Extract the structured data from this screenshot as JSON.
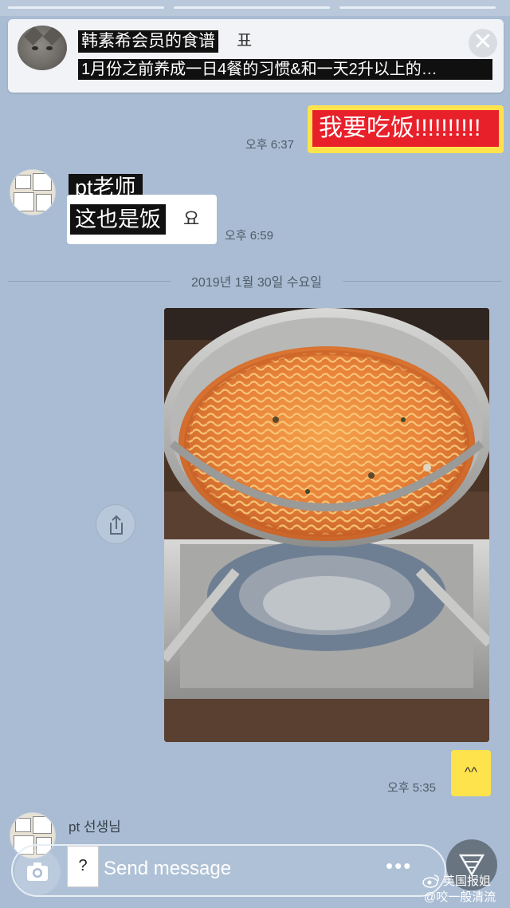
{
  "notice": {
    "title": "韩素希会员的食谱",
    "title_tail": "표",
    "body": "1月份之前养成一日4餐的习惯&和一天2升以上的…",
    "close_symbol": "✕"
  },
  "messages": {
    "out1": {
      "text": "我要吃饭!!!!!!!!!!",
      "time": "오후 6:37"
    },
    "in1": {
      "sender": "pt老师",
      "text": "这也是饭",
      "text_tail": "요",
      "time": "오후 6:59"
    },
    "date_separator": "2019년 1월 30일 수요일",
    "out2": {
      "caption": "^^",
      "time": "오후 5:35"
    },
    "in2": {
      "sender": "pt 선생님"
    }
  },
  "input": {
    "placeholder": "Send message",
    "help_symbol": "?",
    "more_symbol": "•••"
  },
  "watermark": {
    "line1": "英国报姐",
    "line2": "@咬一般清流"
  },
  "colors": {
    "background": "#a9bcd3",
    "outgoing_bubble": "#ffe34d",
    "incoming_bubble": "#ffffff",
    "highlight_red": "#e8202a"
  }
}
